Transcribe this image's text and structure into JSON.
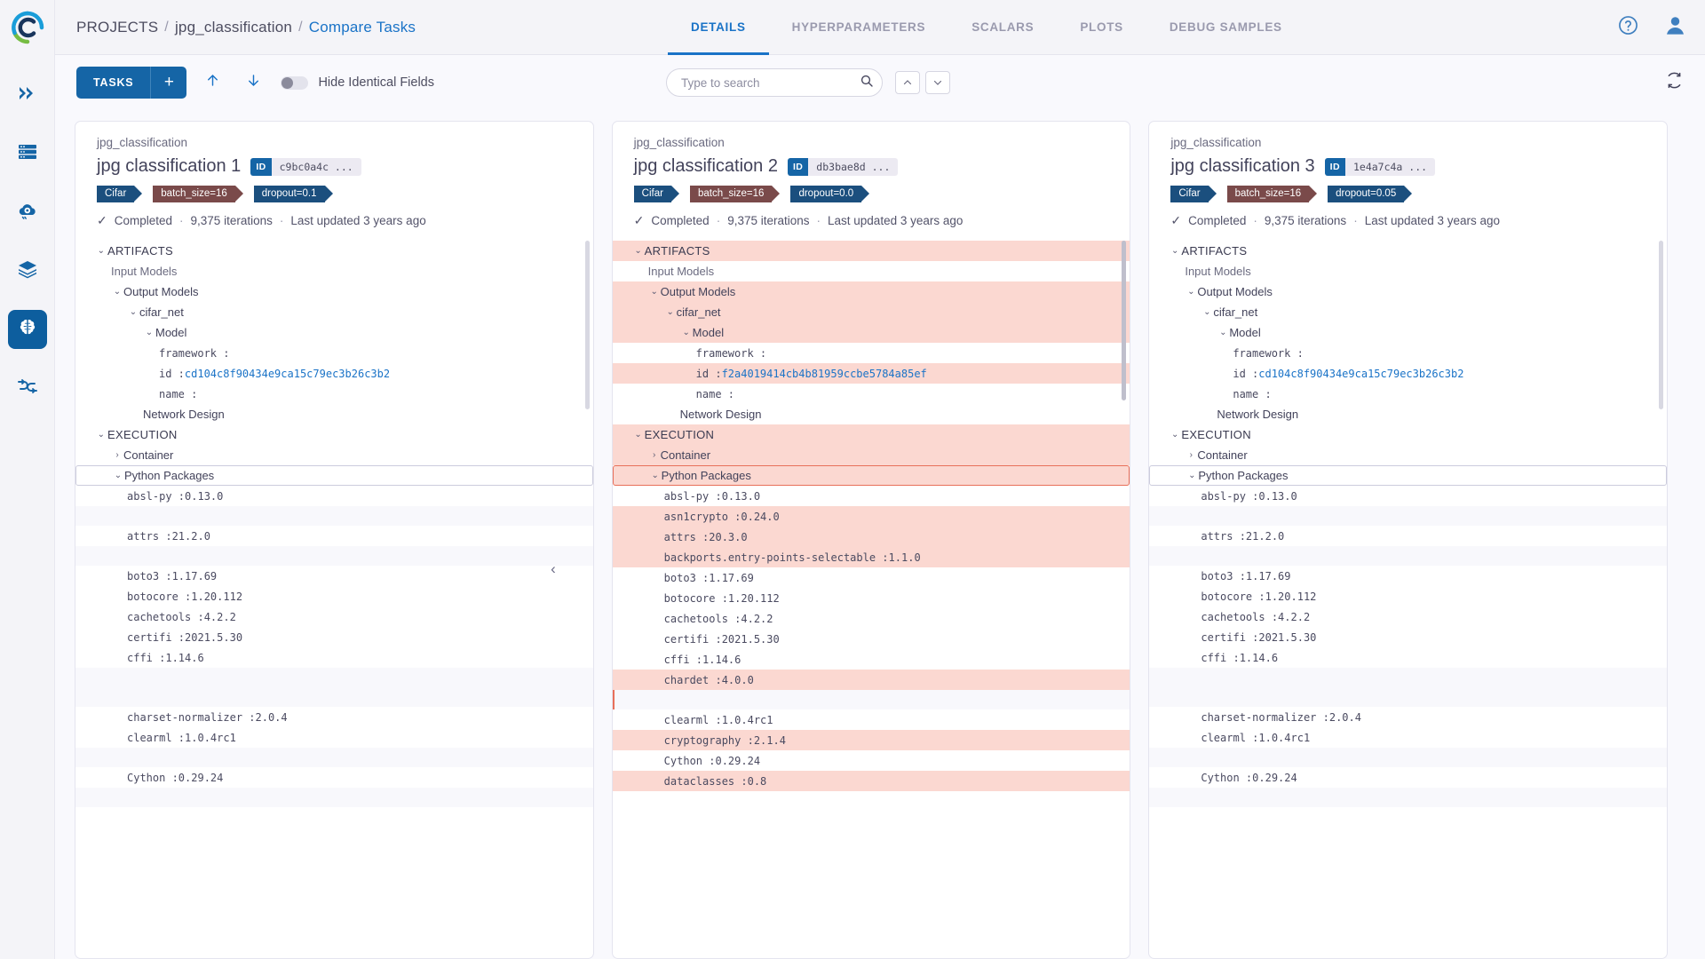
{
  "sidebar": {
    "logo_name": "clearml-logo",
    "items": [
      {
        "name": "pipelines-icon",
        "label": "Pipelines",
        "active": false
      },
      {
        "name": "datasets-icon",
        "label": "Datasets",
        "active": false
      },
      {
        "name": "cloud-settings-icon",
        "label": "Workers and Queues",
        "active": false
      },
      {
        "name": "layers-icon",
        "label": "Models",
        "active": false
      },
      {
        "name": "brain-icon",
        "label": "Experiments",
        "active": true
      },
      {
        "name": "pipeline-flow-icon",
        "label": "Reports",
        "active": false
      }
    ]
  },
  "header": {
    "breadcrumb": {
      "root": "PROJECTS",
      "sep": "/",
      "project": "jpg_classification",
      "current": "Compare Tasks"
    },
    "tabs": [
      {
        "label": "DETAILS",
        "active": true
      },
      {
        "label": "HYPERPARAMETERS",
        "active": false
      },
      {
        "label": "SCALARS",
        "active": false
      },
      {
        "label": "PLOTS",
        "active": false
      },
      {
        "label": "DEBUG SAMPLES",
        "active": false
      }
    ],
    "help_icon": "help-circle-icon",
    "user_icon": "user-avatar-icon"
  },
  "toolbar": {
    "tasks_label": "TASKS",
    "add_label": "+",
    "up_arrow": "↑",
    "down_arrow": "↓",
    "hide_identical_label": "Hide Identical Fields",
    "hide_identical_on": false,
    "search": {
      "placeholder": "Type to search",
      "value": ""
    },
    "prev_match": "⌃",
    "next_match": "⌄",
    "refresh_icon": "refresh-icon"
  },
  "accent_colors": {
    "brand_blue": "#1565a6",
    "link_blue": "#1a73c7",
    "diff_pink": "#fbd8d1",
    "selected_border": "#e8705a",
    "blank_row": "#f8f8fc",
    "tag_blue": "#1b4f7e",
    "tag_brown": "#7a4a4a"
  },
  "columns": [
    {
      "project": "jpg_classification",
      "title": "jpg classification 1",
      "id_label": "ID",
      "id_value": "c9bc0a4c ...",
      "tags": [
        {
          "label": "Cifar",
          "color": "blue"
        },
        {
          "label": "batch_size=16",
          "color": "brown"
        },
        {
          "label": "dropout=0.1",
          "color": "blue"
        }
      ],
      "status": "Completed",
      "iterations": "9,375 iterations",
      "updated": "Last updated 3 years ago",
      "rows": [
        {
          "type": "section",
          "indent": 0,
          "chev": "down",
          "label": "ARTIFACTS",
          "diff": false
        },
        {
          "type": "item",
          "indent": 1,
          "chev": "none",
          "label": "Input Models",
          "muted": true,
          "diff": false
        },
        {
          "type": "item",
          "indent": 1,
          "chev": "down",
          "label": "Output Models",
          "diff": false
        },
        {
          "type": "item",
          "indent": 2,
          "chev": "down",
          "label": "cifar_net",
          "diff": false
        },
        {
          "type": "item",
          "indent": 3,
          "chev": "down",
          "label": "Model",
          "diff": false
        },
        {
          "type": "kv",
          "indent": 4,
          "label": "framework :",
          "value": "",
          "diff": false
        },
        {
          "type": "kv",
          "indent": 4,
          "label": "id :",
          "value": "cd104c8f90434e9ca15c79ec3b26c3b2",
          "link": true,
          "diff": false
        },
        {
          "type": "kv",
          "indent": 4,
          "label": "name :",
          "value": "",
          "diff": false
        },
        {
          "type": "item",
          "indent": 3,
          "chev": "none",
          "label": "Network Design",
          "diff": false
        },
        {
          "type": "section",
          "indent": 0,
          "chev": "down",
          "label": "EXECUTION",
          "diff": false
        },
        {
          "type": "item",
          "indent": 1,
          "chev": "right",
          "label": "Container",
          "diff": false
        },
        {
          "type": "item",
          "indent": 1,
          "chev": "down",
          "label": "Python Packages",
          "selected": true,
          "diff": false
        },
        {
          "type": "kv",
          "indent": 2,
          "label": "absl-py :",
          "value": "0.13.0",
          "diff": false
        },
        {
          "type": "blank",
          "diff": false
        },
        {
          "type": "kv",
          "indent": 2,
          "label": "attrs :",
          "value": "21.2.0",
          "diff": false
        },
        {
          "type": "blank",
          "diff": false
        },
        {
          "type": "kv",
          "indent": 2,
          "label": "boto3 :",
          "value": "1.17.69",
          "diff": false
        },
        {
          "type": "kv",
          "indent": 2,
          "label": "botocore :",
          "value": "1.20.112",
          "diff": false
        },
        {
          "type": "kv",
          "indent": 2,
          "label": "cachetools :",
          "value": "4.2.2",
          "diff": false
        },
        {
          "type": "kv",
          "indent": 2,
          "label": "certifi :",
          "value": "2021.5.30",
          "diff": false
        },
        {
          "type": "kv",
          "indent": 2,
          "label": "cffi :",
          "value": "1.14.6",
          "diff": false
        },
        {
          "type": "blank",
          "diff": false
        },
        {
          "type": "blank2",
          "diff": false
        },
        {
          "type": "kv",
          "indent": 2,
          "label": "charset-normalizer :",
          "value": "2.0.4",
          "diff": false
        },
        {
          "type": "kv",
          "indent": 2,
          "label": "clearml :",
          "value": "1.0.4rc1",
          "diff": false
        },
        {
          "type": "blank",
          "diff": false
        },
        {
          "type": "kv",
          "indent": 2,
          "label": "Cython :",
          "value": "0.29.24",
          "diff": false
        },
        {
          "type": "blank",
          "diff": false
        }
      ]
    },
    {
      "project": "jpg_classification",
      "title": "jpg classification 2",
      "id_label": "ID",
      "id_value": "db3bae8d ...",
      "tags": [
        {
          "label": "Cifar",
          "color": "blue"
        },
        {
          "label": "batch_size=16",
          "color": "brown"
        },
        {
          "label": "dropout=0.0",
          "color": "blue"
        }
      ],
      "status": "Completed",
      "iterations": "9,375 iterations",
      "updated": "Last updated 3 years ago",
      "rows": [
        {
          "type": "section",
          "indent": 0,
          "chev": "down",
          "label": "ARTIFACTS",
          "diff": true
        },
        {
          "type": "item",
          "indent": 1,
          "chev": "none",
          "label": "Input Models",
          "muted": true,
          "diff": false
        },
        {
          "type": "item",
          "indent": 1,
          "chev": "down",
          "label": "Output Models",
          "diff": true
        },
        {
          "type": "item",
          "indent": 2,
          "chev": "down",
          "label": "cifar_net",
          "diff": true
        },
        {
          "type": "item",
          "indent": 3,
          "chev": "down",
          "label": "Model",
          "diff": true
        },
        {
          "type": "kv",
          "indent": 4,
          "label": "framework :",
          "value": "",
          "diff": false
        },
        {
          "type": "kv",
          "indent": 4,
          "label": "id :",
          "value": "f2a4019414cb4b81959ccbe5784a85ef",
          "link": true,
          "diff": true
        },
        {
          "type": "kv",
          "indent": 4,
          "label": "name :",
          "value": "",
          "diff": false
        },
        {
          "type": "item",
          "indent": 3,
          "chev": "none",
          "label": "Network Design",
          "diff": false
        },
        {
          "type": "section",
          "indent": 0,
          "chev": "down",
          "label": "EXECUTION",
          "diff": true
        },
        {
          "type": "item",
          "indent": 1,
          "chev": "right",
          "label": "Container",
          "diff": true
        },
        {
          "type": "item",
          "indent": 1,
          "chev": "down",
          "label": "Python Packages",
          "selected": true,
          "diff": true
        },
        {
          "type": "kv",
          "indent": 2,
          "label": "absl-py :",
          "value": "0.13.0",
          "diff": false
        },
        {
          "type": "kv",
          "indent": 2,
          "label": "asn1crypto :",
          "value": "0.24.0",
          "diff": true
        },
        {
          "type": "kv",
          "indent": 2,
          "label": "attrs :",
          "value": "20.3.0",
          "diff": true
        },
        {
          "type": "kv",
          "indent": 2,
          "label": "backports.entry-points-selectable :",
          "value": "1.1.0",
          "diff": true
        },
        {
          "type": "kv",
          "indent": 2,
          "label": "boto3 :",
          "value": "1.17.69",
          "diff": false
        },
        {
          "type": "kv",
          "indent": 2,
          "label": "botocore :",
          "value": "1.20.112",
          "diff": false
        },
        {
          "type": "kv",
          "indent": 2,
          "label": "cachetools :",
          "value": "4.2.2",
          "diff": false
        },
        {
          "type": "kv",
          "indent": 2,
          "label": "certifi :",
          "value": "2021.5.30",
          "diff": false
        },
        {
          "type": "kv",
          "indent": 2,
          "label": "cffi :",
          "value": "1.14.6",
          "diff": false
        },
        {
          "type": "kv",
          "indent": 2,
          "label": "chardet :",
          "value": "4.0.0",
          "diff": true
        },
        {
          "type": "blank_marked",
          "diff": false
        },
        {
          "type": "kv",
          "indent": 2,
          "label": "clearml :",
          "value": "1.0.4rc1",
          "diff": false
        },
        {
          "type": "kv",
          "indent": 2,
          "label": "cryptography :",
          "value": "2.1.4",
          "diff": true
        },
        {
          "type": "kv",
          "indent": 2,
          "label": "Cython :",
          "value": "0.29.24",
          "diff": false
        },
        {
          "type": "kv",
          "indent": 2,
          "label": "dataclasses :",
          "value": "0.8",
          "diff": true
        }
      ]
    },
    {
      "project": "jpg_classification",
      "title": "jpg classification 3",
      "id_label": "ID",
      "id_value": "1e4a7c4a ...",
      "tags": [
        {
          "label": "Cifar",
          "color": "blue"
        },
        {
          "label": "batch_size=16",
          "color": "brown"
        },
        {
          "label": "dropout=0.05",
          "color": "blue"
        }
      ],
      "status": "Completed",
      "iterations": "9,375 iterations",
      "updated": "Last updated 3 years ago",
      "rows": [
        {
          "type": "section",
          "indent": 0,
          "chev": "down",
          "label": "ARTIFACTS",
          "diff": false
        },
        {
          "type": "item",
          "indent": 1,
          "chev": "none",
          "label": "Input Models",
          "muted": true,
          "diff": false
        },
        {
          "type": "item",
          "indent": 1,
          "chev": "down",
          "label": "Output Models",
          "diff": false
        },
        {
          "type": "item",
          "indent": 2,
          "chev": "down",
          "label": "cifar_net",
          "diff": false
        },
        {
          "type": "item",
          "indent": 3,
          "chev": "down",
          "label": "Model",
          "diff": false
        },
        {
          "type": "kv",
          "indent": 4,
          "label": "framework :",
          "value": "",
          "diff": false
        },
        {
          "type": "kv",
          "indent": 4,
          "label": "id :",
          "value": "cd104c8f90434e9ca15c79ec3b26c3b2",
          "link": true,
          "diff": false
        },
        {
          "type": "kv",
          "indent": 4,
          "label": "name :",
          "value": "",
          "diff": false
        },
        {
          "type": "item",
          "indent": 3,
          "chev": "none",
          "label": "Network Design",
          "diff": false
        },
        {
          "type": "section",
          "indent": 0,
          "chev": "down",
          "label": "EXECUTION",
          "diff": false
        },
        {
          "type": "item",
          "indent": 1,
          "chev": "right",
          "label": "Container",
          "diff": false
        },
        {
          "type": "item",
          "indent": 1,
          "chev": "down",
          "label": "Python Packages",
          "selected": true,
          "diff": false
        },
        {
          "type": "kv",
          "indent": 2,
          "label": "absl-py :",
          "value": "0.13.0",
          "diff": false
        },
        {
          "type": "blank",
          "diff": false
        },
        {
          "type": "kv",
          "indent": 2,
          "label": "attrs :",
          "value": "21.2.0",
          "diff": false
        },
        {
          "type": "blank",
          "diff": false
        },
        {
          "type": "kv",
          "indent": 2,
          "label": "boto3 :",
          "value": "1.17.69",
          "diff": false
        },
        {
          "type": "kv",
          "indent": 2,
          "label": "botocore :",
          "value": "1.20.112",
          "diff": false
        },
        {
          "type": "kv",
          "indent": 2,
          "label": "cachetools :",
          "value": "4.2.2",
          "diff": false
        },
        {
          "type": "kv",
          "indent": 2,
          "label": "certifi :",
          "value": "2021.5.30",
          "diff": false
        },
        {
          "type": "kv",
          "indent": 2,
          "label": "cffi :",
          "value": "1.14.6",
          "diff": false
        },
        {
          "type": "blank",
          "diff": false
        },
        {
          "type": "blank2",
          "diff": false
        },
        {
          "type": "kv",
          "indent": 2,
          "label": "charset-normalizer :",
          "value": "2.0.4",
          "diff": false
        },
        {
          "type": "kv",
          "indent": 2,
          "label": "clearml :",
          "value": "1.0.4rc1",
          "diff": false
        },
        {
          "type": "blank",
          "diff": false
        },
        {
          "type": "kv",
          "indent": 2,
          "label": "Cython :",
          "value": "0.29.24",
          "diff": false
        },
        {
          "type": "blank",
          "diff": false
        }
      ]
    }
  ],
  "collapse_handle": "‹"
}
